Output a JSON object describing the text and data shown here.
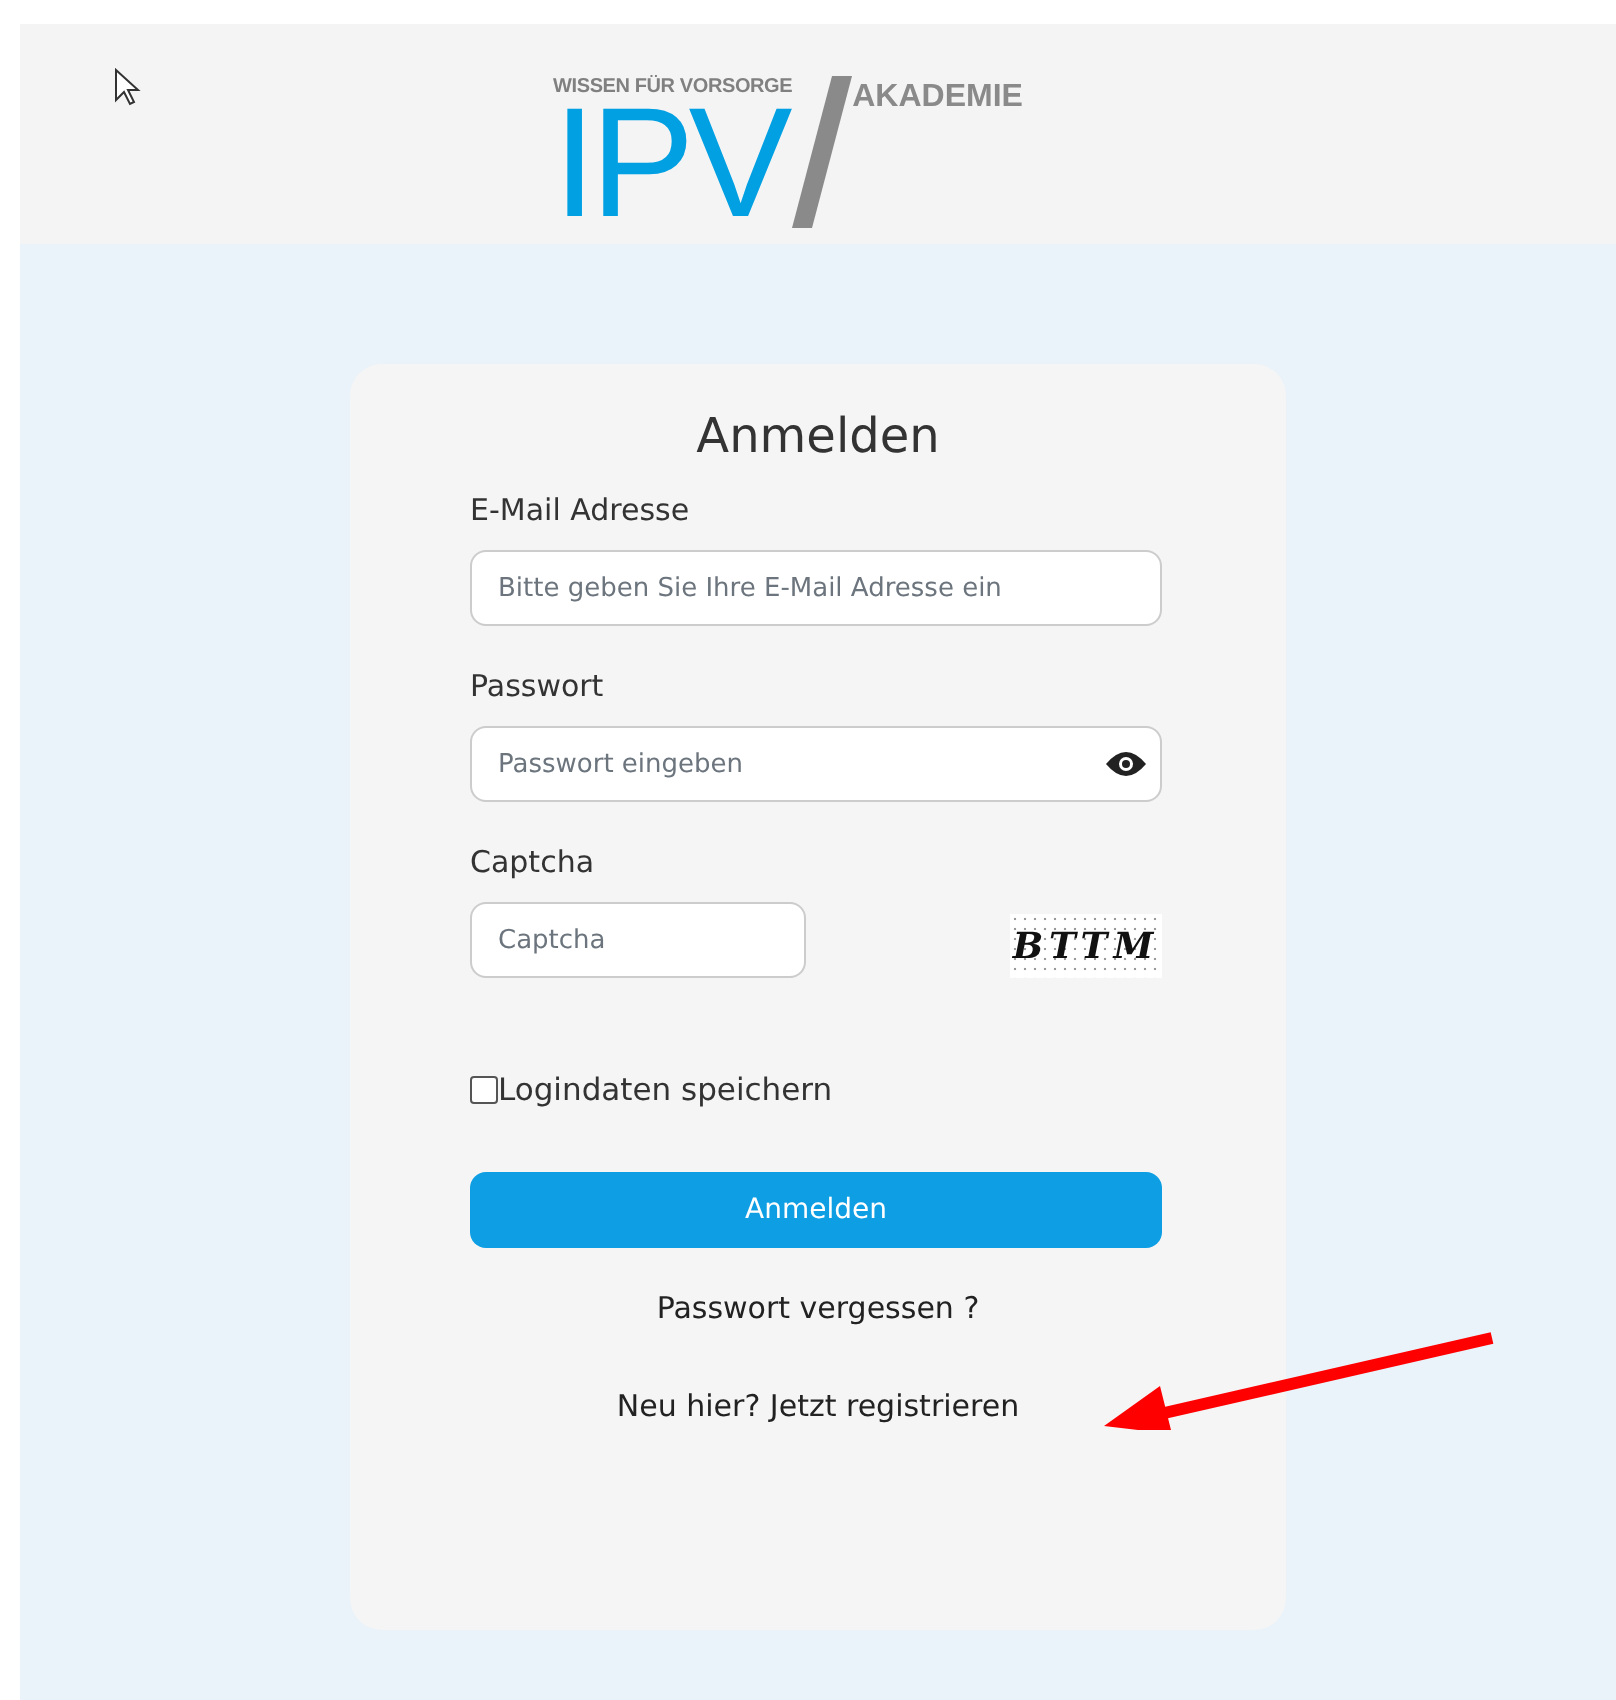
{
  "logo": {
    "tagline": "WISSEN FÜR VORSORGE",
    "brand": "IPV",
    "suffix": "AKADEMIE"
  },
  "form": {
    "title": "Anmelden",
    "fields": [
      {
        "kind": "text",
        "label": "E-Mail Adresse",
        "placeholder": "Bitte geben Sie Ihre E-Mail Adresse ein"
      },
      {
        "kind": "password",
        "label": "Passwort",
        "placeholder": "Passwort eingeben"
      },
      {
        "kind": "captcha",
        "label": "Captcha",
        "placeholder": "Captcha",
        "captcha_text": "BTTM"
      }
    ],
    "remember": {
      "label": "Logindaten speichern",
      "checked": false
    },
    "submit": "Anmelden",
    "forgot_link": "Passwort vergessen ?",
    "register_link": "Neu hier? Jetzt registrieren"
  }
}
